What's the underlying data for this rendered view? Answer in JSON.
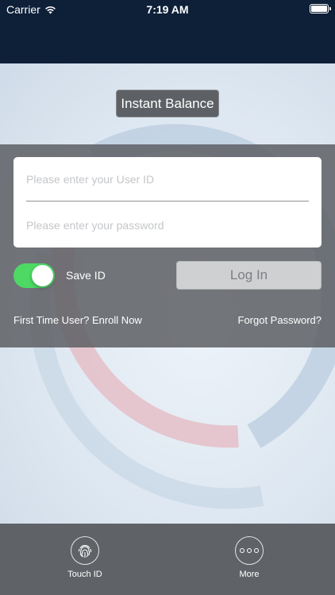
{
  "status_bar": {
    "carrier": "Carrier",
    "time": "7:19 AM"
  },
  "instant_balance_label": "Instant Balance",
  "login": {
    "user_id_placeholder": "Please enter your User ID",
    "password_placeholder": "Please enter your password",
    "save_id_label": "Save ID",
    "save_id_on": true,
    "login_button": "Log In",
    "enroll_link": "First Time User? Enroll Now",
    "forgot_link": "Forgot Password?"
  },
  "bottom_bar": {
    "touch_id_label": "Touch ID",
    "more_label": "More"
  },
  "colors": {
    "header": "#0e1f38",
    "toggle_on": "#4cd964",
    "panel": "#5f6266"
  },
  "icons": {
    "wifi": "wifi-icon",
    "battery": "battery-icon",
    "fingerprint": "fingerprint-icon",
    "more": "more-dots-icon"
  }
}
